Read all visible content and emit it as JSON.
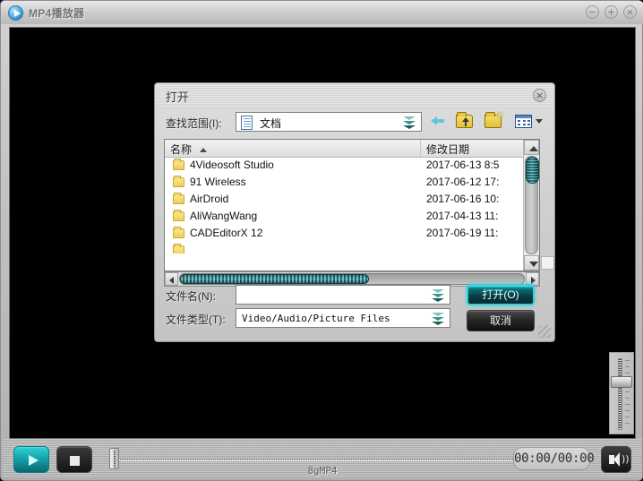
{
  "window": {
    "title": "MP4播放器",
    "app_icon": "play-circle-icon",
    "minimize_label": "−",
    "maximize_label": "+",
    "close_label": "×"
  },
  "player": {
    "play_label": "play-icon",
    "stop_label": "stop-icon",
    "time_display": "00:00/00:00",
    "status_text": "8gMP4",
    "volume_icon": "speaker-icon",
    "volume_waves": "))"
  },
  "dialog": {
    "title": "打开",
    "close_label": "×",
    "lookin_label": "查找范围(I):",
    "lookin_value": "文档",
    "toolbar": {
      "back": "back-icon",
      "up_folder": "up-folder-icon",
      "new_folder": "new-folder-icon",
      "views": "views-icon",
      "new_folder_glyph": "✳"
    },
    "list": {
      "columns": [
        "名称",
        "修改日期"
      ],
      "sort_column": "名称",
      "sort_direction": "ascending",
      "rows": [
        {
          "name": "4Videosoft Studio",
          "date": "2017-06-13 8:5"
        },
        {
          "name": "91 Wireless",
          "date": "2017-06-12 17:"
        },
        {
          "name": "AirDroid",
          "date": "2017-06-16 10:"
        },
        {
          "name": "AliWangWang",
          "date": "2017-04-13 11:"
        },
        {
          "name": "CADEditorX 12",
          "date": "2017-06-19 11:"
        }
      ]
    },
    "filename_label": "文件名(N):",
    "filename_value": "",
    "filename_placeholder": "",
    "filetype_label": "文件类型(T):",
    "filetype_value": "Video/Audio/Picture Files",
    "open_button": "打开(O)",
    "cancel_button": "取消"
  },
  "colors": {
    "accent_cyan": "#2ad4de",
    "folder_yellow": "#f0cf53",
    "window_gray": "#c9c9c9",
    "video_black": "#000000"
  }
}
